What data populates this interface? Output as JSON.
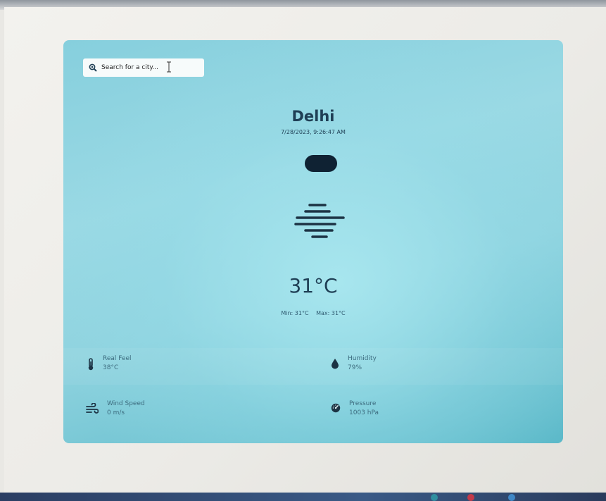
{
  "search": {
    "placeholder": "Search for a city..."
  },
  "weather": {
    "city": "Delhi",
    "datetime": "7/28/2023, 9:26:47 AM",
    "condition_icon": "haze-icon",
    "temperature": "31°C",
    "min": "Min: 31°C",
    "max": "Max: 31°C"
  },
  "details": {
    "real_feel": {
      "label": "Real Feel",
      "value": "38°C",
      "icon": "thermometer-icon"
    },
    "humidity": {
      "label": "Humidity",
      "value": "79%",
      "icon": "droplet-icon"
    },
    "wind_speed": {
      "label": "Wind Speed",
      "value": "0 m/s",
      "icon": "wind-icon"
    },
    "pressure": {
      "label": "Pressure",
      "value": "1003 hPa",
      "icon": "gauge-icon"
    }
  },
  "colors": {
    "card_top": "#86cfdd",
    "card_bottom": "#5ab8c8",
    "text_primary": "#1f3f55",
    "text_secondary": "#3c6b7e",
    "pill": "#0f2233"
  }
}
